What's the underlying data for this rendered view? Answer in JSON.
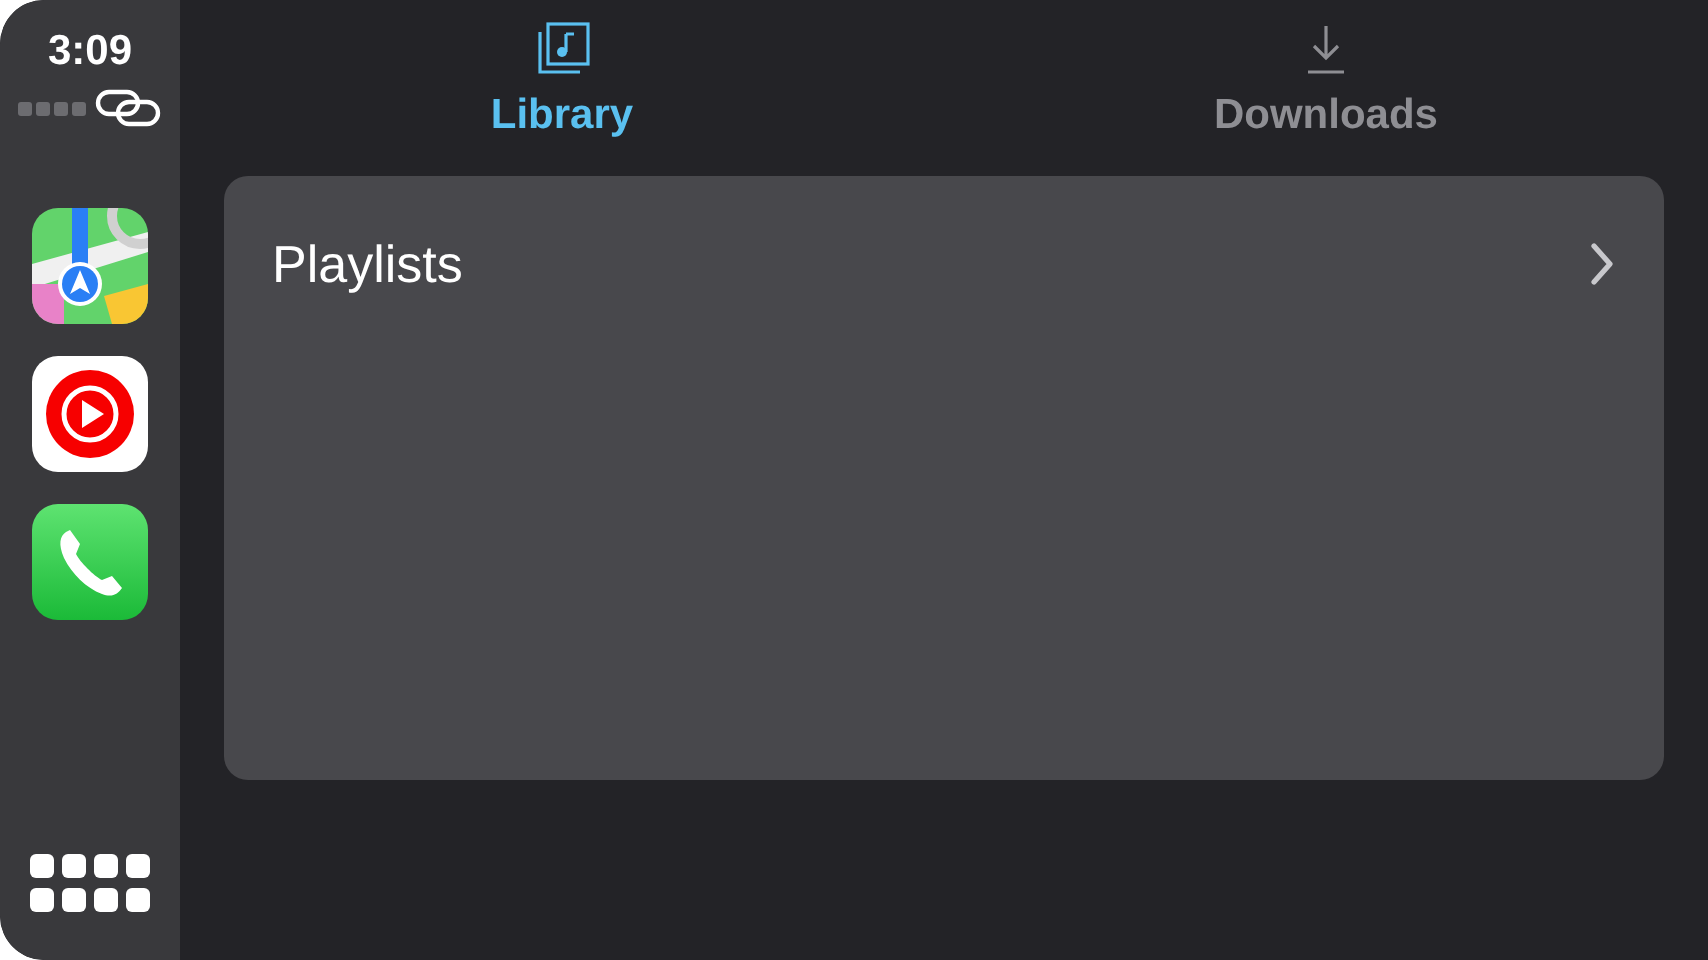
{
  "status": {
    "time": "3:09"
  },
  "dock": {
    "apps": [
      {
        "kind": "maps"
      },
      {
        "kind": "music"
      },
      {
        "kind": "phone"
      }
    ]
  },
  "tabs": [
    {
      "label": "Library",
      "kind": "library",
      "selected": true
    },
    {
      "label": "Downloads",
      "kind": "downloads",
      "selected": false
    }
  ],
  "list": {
    "items": [
      {
        "label": "Playlists"
      }
    ]
  }
}
